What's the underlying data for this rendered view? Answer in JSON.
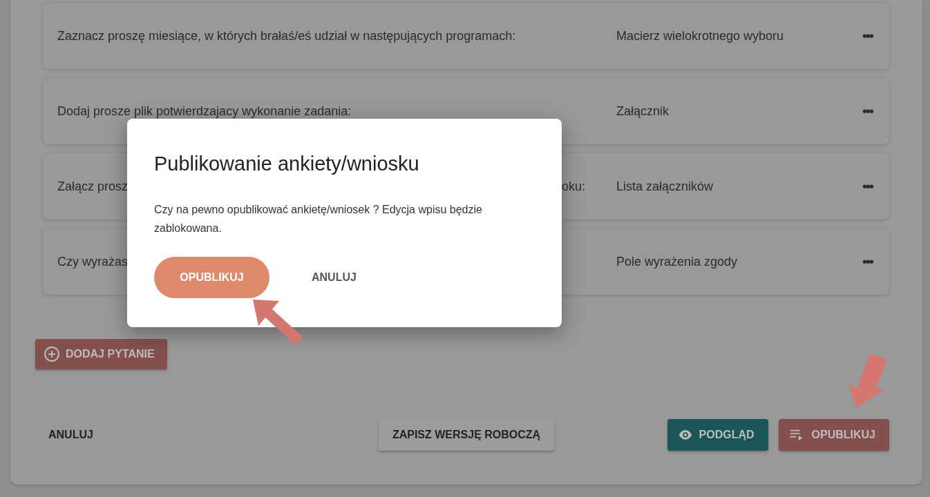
{
  "questions": [
    {
      "question": "Zaznacz proszę miesiące, w których brałaś/eś udział w następujących programach:",
      "type": "Macierz wielokrotnego wyboru",
      "menu": "•••"
    },
    {
      "question": "Dodaj prosze plik potwierdzajacy wykonanie zadania:",
      "type": "Załącznik",
      "menu": "•••"
    },
    {
      "question": "Załącz prosz",
      "question_tail": "oku:",
      "type": "Lista załączników",
      "menu": "•••"
    },
    {
      "question": "Czy wyrażas",
      "type": "Pole wyrażenia zgody",
      "menu": "•••"
    }
  ],
  "add_question_button": "DODAJ PYTANIE",
  "footer": {
    "cancel": "ANULUJ",
    "save_draft": "ZAPISZ WERSJĘ ROBOCZĄ",
    "preview": "PODGLĄD",
    "publish": "OPUBLIKUJ"
  },
  "dialog": {
    "title": "Publikowanie ankiety/wniosku",
    "message": "Czy na pewno opublikować ankietę/wniosek ? Edycja wpisu będzie zablokowana.",
    "confirm": "OPUBLIKUJ",
    "cancel": "ANULUJ"
  }
}
